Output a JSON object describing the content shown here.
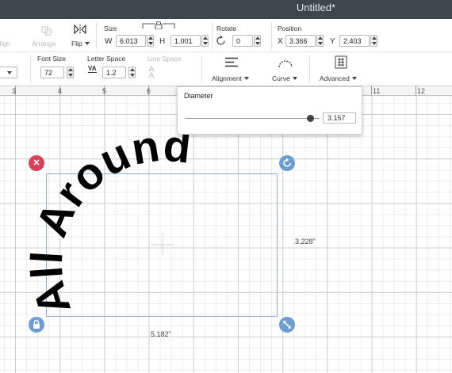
{
  "window": {
    "title": "Untitled*"
  },
  "toolbar": {
    "align_label": "Align",
    "arrange_label": "Arrange",
    "flip_label": "Flip",
    "size": {
      "label": "Size",
      "w_label": "W",
      "w_value": "6.013",
      "h_label": "H",
      "h_value": "1.001"
    },
    "rotate": {
      "label": "Rotate",
      "value": "0"
    },
    "position": {
      "label": "Position",
      "x_label": "X",
      "x_value": "3.366",
      "y_label": "Y",
      "y_value": "2.403"
    }
  },
  "text_toolbar": {
    "font_size_label": "Font Size",
    "font_size_value": "72",
    "letter_space_label": "Letter Space",
    "letter_space_value": "1.2",
    "letter_space_icon_text": "VA",
    "line_space_label": "Line Space",
    "alignment_label": "Alignment",
    "curve_label": "Curve",
    "advanced_label": "Advanced"
  },
  "ruler": {
    "numbers": [
      "3",
      "4",
      "5",
      "6",
      "11",
      "12"
    ]
  },
  "curve_popup": {
    "title": "Diameter",
    "value": "3.157",
    "slider_fraction": 0.93
  },
  "canvas": {
    "text_object": "All Around",
    "width_label": "5.182\"",
    "height_label": "3.228\""
  },
  "colors": {
    "titlebar": "#3f4549",
    "delete_handle": "#d8415a",
    "handle": "#6f9dcf",
    "selection": "#8fb0cc"
  },
  "icons": [
    "flip-icon",
    "lock-icon",
    "rotate-icon",
    "align-left-icon",
    "curve-icon",
    "advanced-icon",
    "delete-icon",
    "resize-icon"
  ]
}
